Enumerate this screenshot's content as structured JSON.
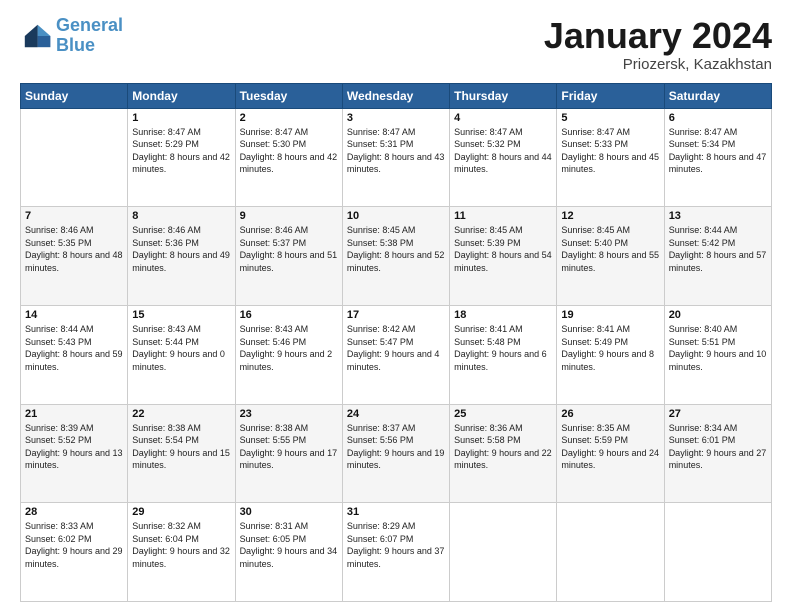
{
  "header": {
    "logo_line1": "General",
    "logo_line2": "Blue",
    "month": "January 2024",
    "location": "Priozersk, Kazakhstan"
  },
  "weekdays": [
    "Sunday",
    "Monday",
    "Tuesday",
    "Wednesday",
    "Thursday",
    "Friday",
    "Saturday"
  ],
  "weeks": [
    [
      {
        "day": "",
        "sunrise": "",
        "sunset": "",
        "daylight": ""
      },
      {
        "day": "1",
        "sunrise": "Sunrise: 8:47 AM",
        "sunset": "Sunset: 5:29 PM",
        "daylight": "Daylight: 8 hours and 42 minutes."
      },
      {
        "day": "2",
        "sunrise": "Sunrise: 8:47 AM",
        "sunset": "Sunset: 5:30 PM",
        "daylight": "Daylight: 8 hours and 42 minutes."
      },
      {
        "day": "3",
        "sunrise": "Sunrise: 8:47 AM",
        "sunset": "Sunset: 5:31 PM",
        "daylight": "Daylight: 8 hours and 43 minutes."
      },
      {
        "day": "4",
        "sunrise": "Sunrise: 8:47 AM",
        "sunset": "Sunset: 5:32 PM",
        "daylight": "Daylight: 8 hours and 44 minutes."
      },
      {
        "day": "5",
        "sunrise": "Sunrise: 8:47 AM",
        "sunset": "Sunset: 5:33 PM",
        "daylight": "Daylight: 8 hours and 45 minutes."
      },
      {
        "day": "6",
        "sunrise": "Sunrise: 8:47 AM",
        "sunset": "Sunset: 5:34 PM",
        "daylight": "Daylight: 8 hours and 47 minutes."
      }
    ],
    [
      {
        "day": "7",
        "sunrise": "Sunrise: 8:46 AM",
        "sunset": "Sunset: 5:35 PM",
        "daylight": "Daylight: 8 hours and 48 minutes."
      },
      {
        "day": "8",
        "sunrise": "Sunrise: 8:46 AM",
        "sunset": "Sunset: 5:36 PM",
        "daylight": "Daylight: 8 hours and 49 minutes."
      },
      {
        "day": "9",
        "sunrise": "Sunrise: 8:46 AM",
        "sunset": "Sunset: 5:37 PM",
        "daylight": "Daylight: 8 hours and 51 minutes."
      },
      {
        "day": "10",
        "sunrise": "Sunrise: 8:45 AM",
        "sunset": "Sunset: 5:38 PM",
        "daylight": "Daylight: 8 hours and 52 minutes."
      },
      {
        "day": "11",
        "sunrise": "Sunrise: 8:45 AM",
        "sunset": "Sunset: 5:39 PM",
        "daylight": "Daylight: 8 hours and 54 minutes."
      },
      {
        "day": "12",
        "sunrise": "Sunrise: 8:45 AM",
        "sunset": "Sunset: 5:40 PM",
        "daylight": "Daylight: 8 hours and 55 minutes."
      },
      {
        "day": "13",
        "sunrise": "Sunrise: 8:44 AM",
        "sunset": "Sunset: 5:42 PM",
        "daylight": "Daylight: 8 hours and 57 minutes."
      }
    ],
    [
      {
        "day": "14",
        "sunrise": "Sunrise: 8:44 AM",
        "sunset": "Sunset: 5:43 PM",
        "daylight": "Daylight: 8 hours and 59 minutes."
      },
      {
        "day": "15",
        "sunrise": "Sunrise: 8:43 AM",
        "sunset": "Sunset: 5:44 PM",
        "daylight": "Daylight: 9 hours and 0 minutes."
      },
      {
        "day": "16",
        "sunrise": "Sunrise: 8:43 AM",
        "sunset": "Sunset: 5:46 PM",
        "daylight": "Daylight: 9 hours and 2 minutes."
      },
      {
        "day": "17",
        "sunrise": "Sunrise: 8:42 AM",
        "sunset": "Sunset: 5:47 PM",
        "daylight": "Daylight: 9 hours and 4 minutes."
      },
      {
        "day": "18",
        "sunrise": "Sunrise: 8:41 AM",
        "sunset": "Sunset: 5:48 PM",
        "daylight": "Daylight: 9 hours and 6 minutes."
      },
      {
        "day": "19",
        "sunrise": "Sunrise: 8:41 AM",
        "sunset": "Sunset: 5:49 PM",
        "daylight": "Daylight: 9 hours and 8 minutes."
      },
      {
        "day": "20",
        "sunrise": "Sunrise: 8:40 AM",
        "sunset": "Sunset: 5:51 PM",
        "daylight": "Daylight: 9 hours and 10 minutes."
      }
    ],
    [
      {
        "day": "21",
        "sunrise": "Sunrise: 8:39 AM",
        "sunset": "Sunset: 5:52 PM",
        "daylight": "Daylight: 9 hours and 13 minutes."
      },
      {
        "day": "22",
        "sunrise": "Sunrise: 8:38 AM",
        "sunset": "Sunset: 5:54 PM",
        "daylight": "Daylight: 9 hours and 15 minutes."
      },
      {
        "day": "23",
        "sunrise": "Sunrise: 8:38 AM",
        "sunset": "Sunset: 5:55 PM",
        "daylight": "Daylight: 9 hours and 17 minutes."
      },
      {
        "day": "24",
        "sunrise": "Sunrise: 8:37 AM",
        "sunset": "Sunset: 5:56 PM",
        "daylight": "Daylight: 9 hours and 19 minutes."
      },
      {
        "day": "25",
        "sunrise": "Sunrise: 8:36 AM",
        "sunset": "Sunset: 5:58 PM",
        "daylight": "Daylight: 9 hours and 22 minutes."
      },
      {
        "day": "26",
        "sunrise": "Sunrise: 8:35 AM",
        "sunset": "Sunset: 5:59 PM",
        "daylight": "Daylight: 9 hours and 24 minutes."
      },
      {
        "day": "27",
        "sunrise": "Sunrise: 8:34 AM",
        "sunset": "Sunset: 6:01 PM",
        "daylight": "Daylight: 9 hours and 27 minutes."
      }
    ],
    [
      {
        "day": "28",
        "sunrise": "Sunrise: 8:33 AM",
        "sunset": "Sunset: 6:02 PM",
        "daylight": "Daylight: 9 hours and 29 minutes."
      },
      {
        "day": "29",
        "sunrise": "Sunrise: 8:32 AM",
        "sunset": "Sunset: 6:04 PM",
        "daylight": "Daylight: 9 hours and 32 minutes."
      },
      {
        "day": "30",
        "sunrise": "Sunrise: 8:31 AM",
        "sunset": "Sunset: 6:05 PM",
        "daylight": "Daylight: 9 hours and 34 minutes."
      },
      {
        "day": "31",
        "sunrise": "Sunrise: 8:29 AM",
        "sunset": "Sunset: 6:07 PM",
        "daylight": "Daylight: 9 hours and 37 minutes."
      },
      {
        "day": "",
        "sunrise": "",
        "sunset": "",
        "daylight": ""
      },
      {
        "day": "",
        "sunrise": "",
        "sunset": "",
        "daylight": ""
      },
      {
        "day": "",
        "sunrise": "",
        "sunset": "",
        "daylight": ""
      }
    ]
  ]
}
